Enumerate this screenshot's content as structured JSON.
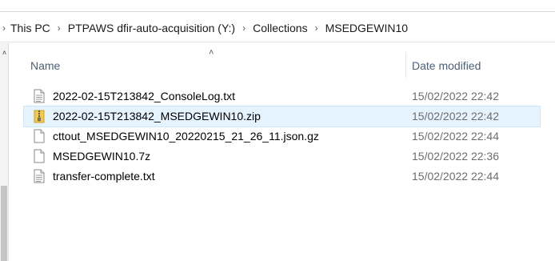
{
  "breadcrumb": {
    "items": [
      "This PC",
      "PTPAWS dfir-auto-acquisition (Y:)",
      "Collections",
      "MSEDGEWIN10"
    ]
  },
  "columns": {
    "name": "Name",
    "date_modified": "Date modified",
    "sort": "ascending"
  },
  "files": [
    {
      "name": "2022-02-15T213842_ConsoleLog.txt",
      "date": "15/02/2022 22:42",
      "icon": "text-file-icon",
      "selected": false
    },
    {
      "name": "2022-02-15T213842_MSEDGEWIN10.zip",
      "date": "15/02/2022 22:42",
      "icon": "zip-folder-icon",
      "selected": true
    },
    {
      "name": "cttout_MSEDGEWIN10_20220215_21_26_11.json.gz",
      "date": "15/02/2022 22:44",
      "icon": "blank-file-icon",
      "selected": false
    },
    {
      "name": "MSEDGEWIN10.7z",
      "date": "15/02/2022 22:36",
      "icon": "blank-file-icon",
      "selected": false
    },
    {
      "name": "transfer-complete.txt",
      "date": "15/02/2022 22:44",
      "icon": "text-file-icon",
      "selected": false
    }
  ],
  "colors": {
    "selection": "#e5f3ff",
    "header_text": "#4c607a",
    "date_text": "#6d6d6d"
  }
}
